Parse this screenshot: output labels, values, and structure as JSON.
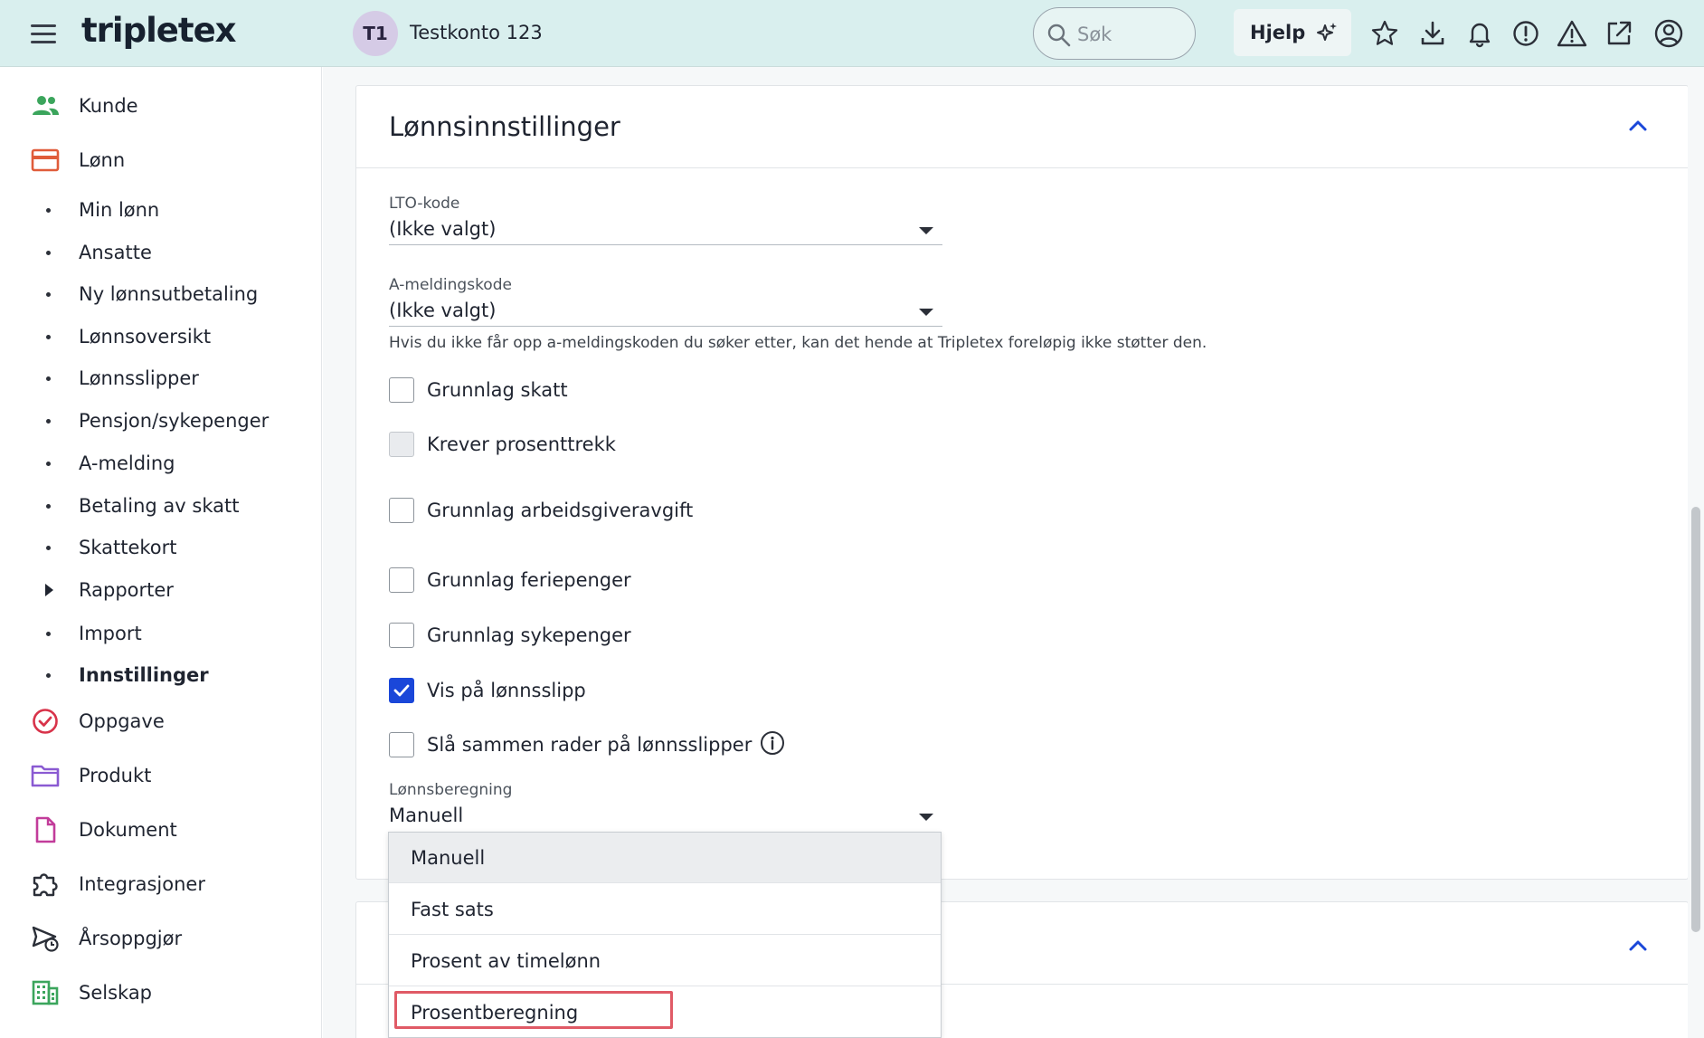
{
  "header": {
    "logo": "tripletex",
    "account_initials": "T1",
    "account_name": "Testkonto 123",
    "search_placeholder": "Søk",
    "help_label": "Hjelp"
  },
  "sidebar": {
    "items": [
      {
        "label": "Kunde",
        "icon": "users-icon"
      },
      {
        "label": "Lønn",
        "icon": "payroll-card-icon"
      }
    ],
    "sub_items": [
      {
        "label": "Min lønn"
      },
      {
        "label": "Ansatte"
      },
      {
        "label": "Ny lønnsutbetaling"
      },
      {
        "label": "Lønnsoversikt"
      },
      {
        "label": "Lønnsslipper"
      },
      {
        "label": "Pensjon/sykepenger"
      },
      {
        "label": "A-melding"
      },
      {
        "label": "Betaling av skatt"
      },
      {
        "label": "Skattekort"
      },
      {
        "label": "Rapporter"
      },
      {
        "label": "Import"
      },
      {
        "label": "Innstillinger"
      }
    ],
    "items_bottom": [
      {
        "label": "Oppgave",
        "icon": "task-check-icon"
      },
      {
        "label": "Produkt",
        "icon": "folder-icon"
      },
      {
        "label": "Dokument",
        "icon": "document-icon"
      },
      {
        "label": "Integrasjoner",
        "icon": "puzzle-icon"
      },
      {
        "label": "Årsoppgjør",
        "icon": "send-clock-icon"
      },
      {
        "label": "Selskap",
        "icon": "building-icon"
      }
    ]
  },
  "card": {
    "title": "Lønnsinnstillinger",
    "lto_label": "LTO-kode",
    "lto_value": "(Ikke valgt)",
    "amelding_label": "A-meldingskode",
    "amelding_value": "(Ikke valgt)",
    "amelding_hint": "Hvis du ikke får opp a-meldingskoden du søker etter, kan det hende at Tripletex foreløpig ikke støtter den.",
    "checkboxes": [
      {
        "label": "Grunnlag skatt",
        "checked": false
      },
      {
        "label": "Krever prosenttrekk",
        "checked": false,
        "disabled": true
      },
      {
        "label": "Grunnlag arbeidsgiveravgift",
        "checked": false
      },
      {
        "label": "Grunnlag feriepenger",
        "checked": false
      },
      {
        "label": "Grunnlag sykepenger",
        "checked": false
      },
      {
        "label": "Vis på lønnsslipp",
        "checked": true
      },
      {
        "label": "Slå sammen rader på lønnsslipper",
        "checked": false
      }
    ],
    "calc_label": "Lønnsberegning",
    "calc_value": "Manuell",
    "calc_options": [
      {
        "label": "Manuell"
      },
      {
        "label": "Fast sats"
      },
      {
        "label": "Prosent av timelønn"
      },
      {
        "label": "Prosentberegning"
      }
    ]
  },
  "colors": {
    "topbar": "#d9efee",
    "accent": "#1a47d9",
    "highlight": "#e05a66"
  }
}
